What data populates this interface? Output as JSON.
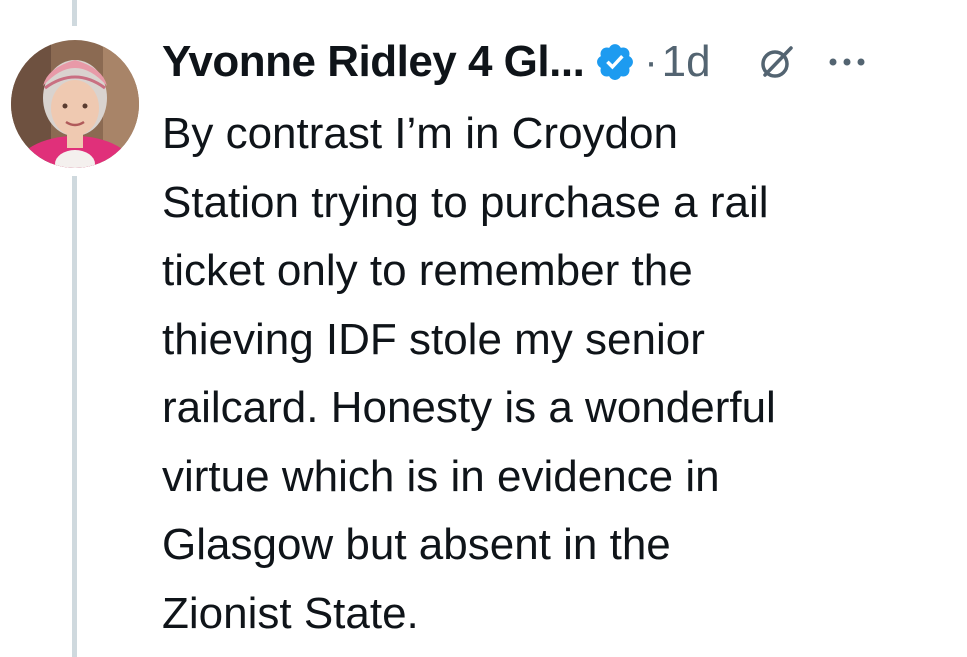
{
  "author": {
    "display_name": "Yvonne Ridley 4 Gl...",
    "verified": true,
    "timestamp": "1d",
    "separator": "·"
  },
  "icons": {
    "avatar": "profile-photo",
    "verified": "verified-badge-icon",
    "grok": "grok-icon",
    "more": "more-options-icon"
  },
  "colors": {
    "text": "#0f1419",
    "secondary": "#536471",
    "verified_blue": "#1d9bf0",
    "thread_line": "#cfd9de"
  },
  "tweet": {
    "lines": [
      "By contrast I’m in Croydon",
      "Station trying to purchase a rail",
      "ticket only to remember the",
      "thieving IDF stole my senior",
      "railcard. Honesty is a wonderful",
      "virtue which is in evidence in",
      "Glasgow but absent in the",
      "Zionist State."
    ]
  }
}
